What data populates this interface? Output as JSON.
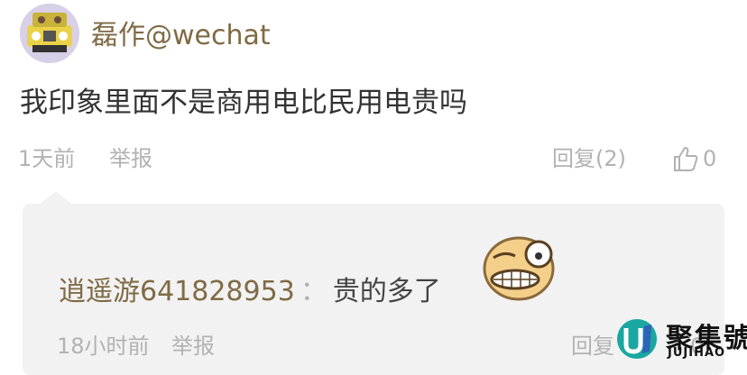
{
  "comment": {
    "username": "磊作@wechat",
    "text": "我印象里面不是商用电比民用电贵吗",
    "time": "1天前",
    "report_label": "举报",
    "reply_label": "回复(2)",
    "like_count": "0"
  },
  "reply": {
    "username": "逍遥游641828953",
    "separator": "：",
    "text": "贵的多了",
    "emoji": "grin-emoji",
    "time": "18小时前",
    "report_label": "举报",
    "reply_label": "回复",
    "like_count": "0"
  },
  "watermark": {
    "title": "聚集號",
    "subtitle": "JUJIHAO"
  },
  "colors": {
    "username": "#7f6b45",
    "meta": "#b2b2b2",
    "reply_bg": "#f2f2f2"
  }
}
